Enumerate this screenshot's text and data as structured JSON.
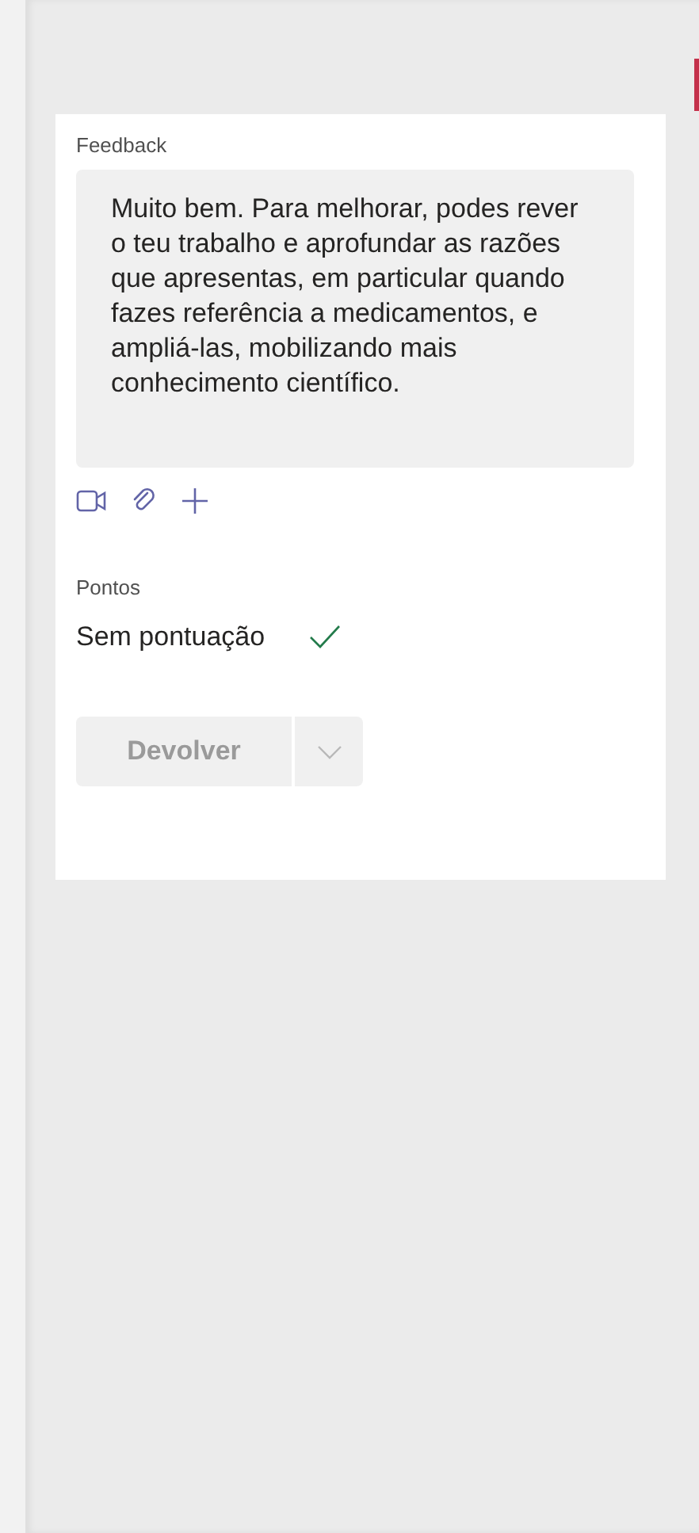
{
  "feedback": {
    "label": "Feedback",
    "text": "Muito bem. Para melhorar, podes rever o teu trabalho e aprofundar as razões que apresentas, em particular quando fazes referência a medicamentos, e ampliá-las, mobilizando mais conhecimento científico."
  },
  "points": {
    "label": "Pontos",
    "value": "Sem pontuação",
    "confirmed": true
  },
  "return_button": {
    "label": "Devolver",
    "disabled": true
  }
}
